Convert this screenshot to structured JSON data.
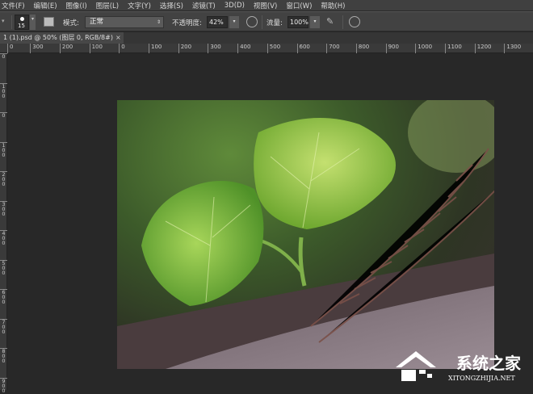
{
  "menu": [
    "文件(F)",
    "编辑(E)",
    "图像(I)",
    "图层(L)",
    "文字(Y)",
    "选择(S)",
    "滤镜(T)",
    "3D(D)",
    "视图(V)",
    "窗口(W)",
    "帮助(H)"
  ],
  "options": {
    "brush_size": "15",
    "mode_label": "模式:",
    "mode_value": "正常",
    "opacity_label": "不透明度:",
    "opacity_value": "42%",
    "flow_label": "流量:",
    "flow_value": "100%"
  },
  "tab": {
    "title": "1 (1).psd @ 50% (图层 0, RGB/8#)",
    "close": "×"
  },
  "ruler": {
    "horizontal": [
      "0",
      "300",
      "200",
      "100",
      "0",
      "100",
      "200",
      "300",
      "400",
      "500",
      "600",
      "700",
      "800",
      "900",
      "1000",
      "1100",
      "1200",
      "1300"
    ],
    "vertical": [
      "0",
      "100",
      "0",
      "100",
      "200",
      "300",
      "400",
      "500",
      "600",
      "700",
      "800",
      "900"
    ]
  },
  "watermark": {
    "name": "系统之家",
    "url": "XITONGZHIJIA.NET"
  }
}
